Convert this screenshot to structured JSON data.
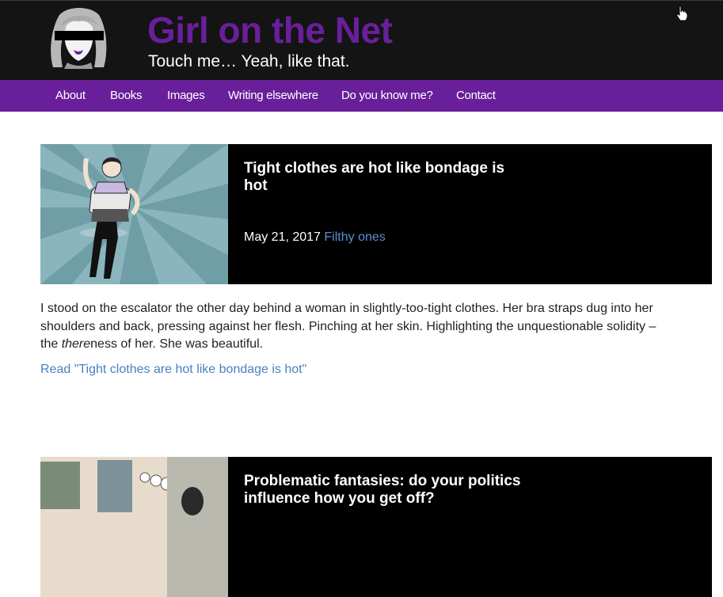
{
  "site": {
    "title": "Girl on the Net",
    "tagline": "Touch me… Yeah, like that."
  },
  "nav": {
    "items": [
      {
        "label": "About"
      },
      {
        "label": "Books"
      },
      {
        "label": "Images"
      },
      {
        "label": "Writing elsewhere"
      },
      {
        "label": "Do you know me?"
      },
      {
        "label": "Contact"
      }
    ]
  },
  "posts": [
    {
      "title": "Tight clothes are hot like bondage is hot",
      "date": "May 21, 2017",
      "category": "Filthy ones",
      "excerpt_before": "I stood on the escalator the other day behind a woman in slightly-too-tight clothes. Her bra straps dug into her shoulders and back, pressing against her flesh. Pinching at her skin. Highlighting the unquestionable solidity – the ",
      "excerpt_em": "there",
      "excerpt_after": "ness of her. She was beautiful.",
      "read_more": "Read \"Tight clothes are hot like bondage is hot\""
    },
    {
      "title": "Problematic fantasies: do your politics influence how you get off?"
    }
  ],
  "colors": {
    "header_bg": "#141414",
    "brand_purple": "#6a1f9a",
    "link_blue": "#4a7fc1",
    "thumb_teal": "#8ab5bd"
  },
  "icons": {
    "logo": "girl-logo-icon",
    "cursor": "hand-cursor-icon"
  }
}
